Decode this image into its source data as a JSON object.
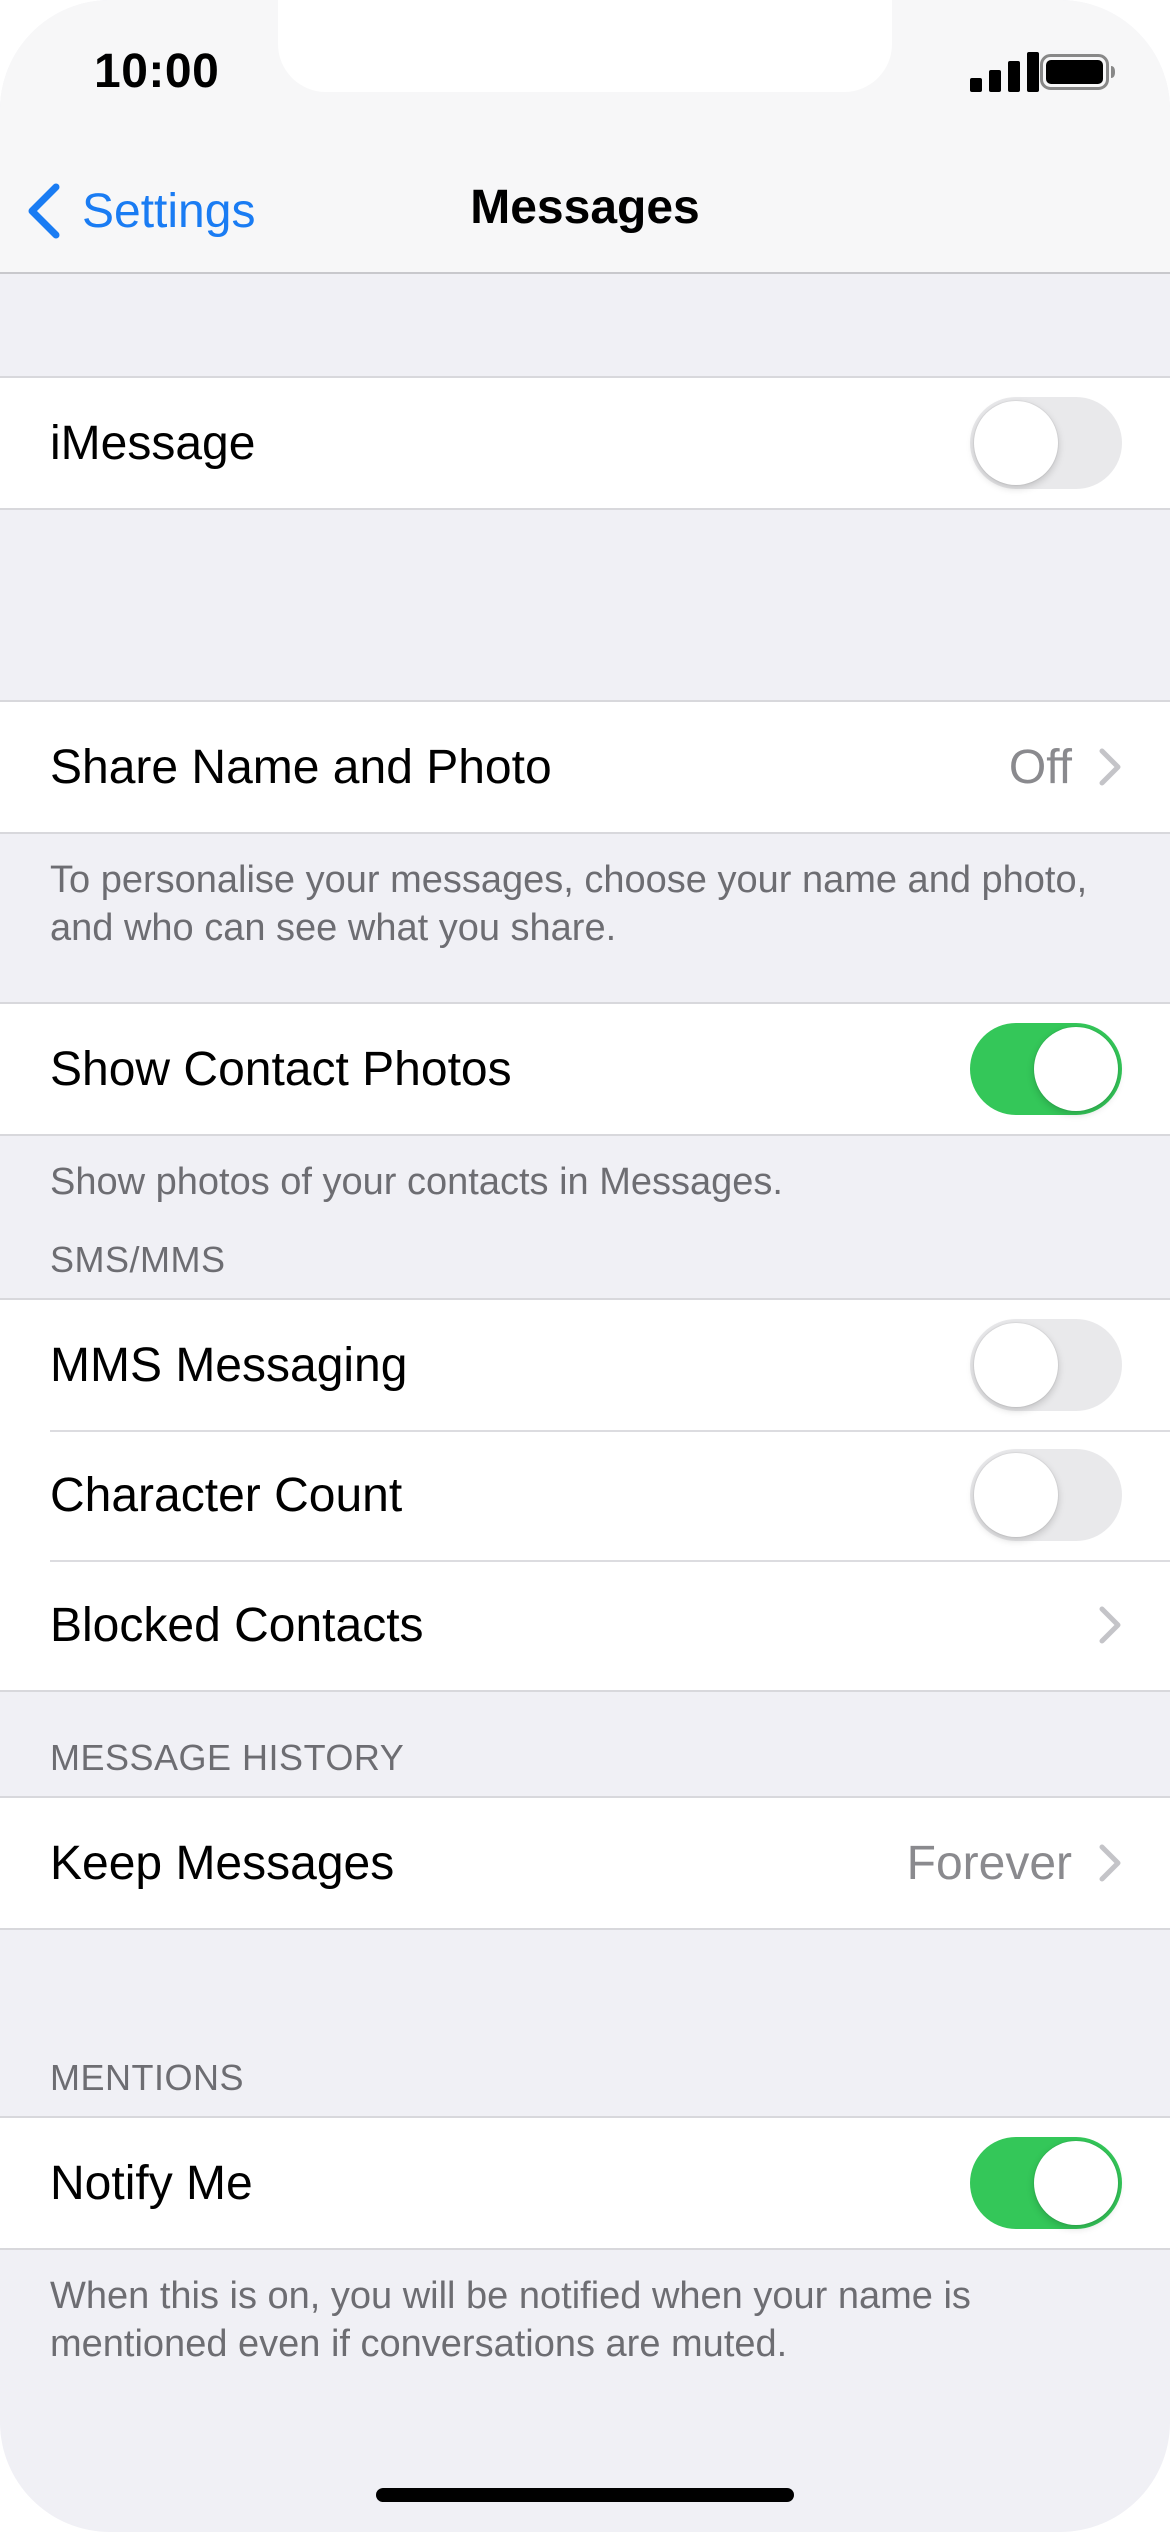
{
  "status_bar": {
    "time": "10:00",
    "signal_icon": "cellular-signal-icon",
    "battery_icon": "battery-full-icon"
  },
  "nav": {
    "back_label": "Settings",
    "title": "Messages"
  },
  "sections": {
    "imessage": {
      "label": "iMessage",
      "toggle_on": false
    },
    "share_name": {
      "label": "Share Name and Photo",
      "value": "Off",
      "footer": "To personalise your messages, choose your name and photo, and who can see what you share."
    },
    "contact_photos": {
      "label": "Show Contact Photos",
      "toggle_on": true,
      "footer": "Show photos of your contacts in Messages."
    },
    "sms_mms": {
      "header": "SMS/MMS",
      "mms_label": "MMS Messaging",
      "mms_on": false,
      "char_count_label": "Character Count",
      "char_count_on": false,
      "blocked_label": "Blocked Contacts"
    },
    "history": {
      "header": "MESSAGE HISTORY",
      "keep_label": "Keep Messages",
      "keep_value": "Forever"
    },
    "mentions": {
      "header": "MENTIONS",
      "notify_label": "Notify Me",
      "notify_on": true,
      "footer": "When this is on, you will be notified when your name is mentioned even if conversations are muted."
    }
  },
  "colors": {
    "accent": "#1a7cf3",
    "toggle_on": "#34c759",
    "toggle_off": "#e9e9eb",
    "background": "#f0f0f5",
    "secondary_text": "#6d6d72"
  }
}
